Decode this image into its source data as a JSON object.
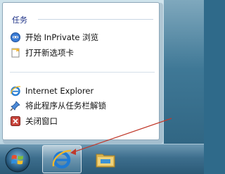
{
  "jumplist": {
    "section_title": "任务",
    "items": [
      {
        "label": "开始 InPrivate 浏览",
        "icon": "inprivate-icon"
      },
      {
        "label": "打开新选项卡",
        "icon": "new-tab-icon"
      },
      {
        "label": "Internet Explorer",
        "icon": "ie-icon"
      },
      {
        "label": "将此程序从任务栏解锁",
        "icon": "unpin-icon"
      },
      {
        "label": "关闭窗口",
        "icon": "close-window-icon"
      }
    ]
  },
  "taskbar": {
    "buttons": [
      {
        "name": "start-button",
        "icon": "windows-logo-icon"
      },
      {
        "name": "internet-explorer-taskbar-button",
        "icon": "ie-icon",
        "active": true
      },
      {
        "name": "windows-explorer-taskbar-button",
        "icon": "folder-icon"
      }
    ]
  },
  "colors": {
    "section_title": "#1e3287",
    "taskbar": "#3d6e8d",
    "annotation_arrow": "#c0392b"
  }
}
